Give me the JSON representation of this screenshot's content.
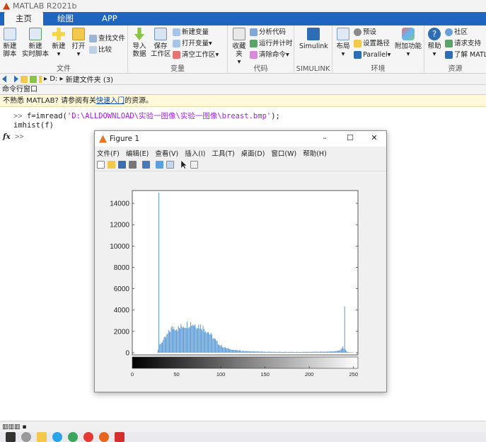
{
  "app": {
    "title": "MATLAB R2021b"
  },
  "tabs": [
    {
      "label": "主页"
    },
    {
      "label": "绘图"
    },
    {
      "label": "APP"
    }
  ],
  "ribbon": {
    "file": {
      "label": "文件",
      "new_script": "新建\n脚本",
      "new_live": "新建\n实时脚本",
      "new": "新建",
      "open": "打开",
      "find_files": "查找文件",
      "compare": "比较"
    },
    "variable": {
      "label": "变量",
      "import": "导入\n数据",
      "save": "保存\n工作区",
      "new_var": "新建变量",
      "open_var": "打开变量",
      "clear_ws": "清空工作区"
    },
    "code": {
      "label": "代码",
      "favorites": "收藏夹",
      "analyze": "分析代码",
      "run_time": "运行并计时",
      "clear_cmd": "清除命令"
    },
    "simulink": {
      "label": "SIMULINK",
      "btn": "Simulink"
    },
    "env": {
      "label": "环境",
      "layout": "布局",
      "prefs": "预设",
      "set_path": "设置路径",
      "parallel": "Parallel",
      "addons": "附加功能"
    },
    "resources": {
      "label": "资源",
      "help": "帮助",
      "community": "社区",
      "support": "请求支持",
      "learn": "了解 MATLAB"
    }
  },
  "path": {
    "drive": "D:",
    "folder": "新建文件夹 (3)"
  },
  "command_window": {
    "title": "命令行窗口",
    "info_prefix": "不熟悉 MATLAB? 请参阅有关",
    "info_link": "快速入门",
    "info_suffix": "的资源。",
    "prompt": ">>",
    "fx": "fx",
    "line1_code": "f=imread(",
    "line1_str": "'D:\\ALLDOWNLOAD\\实验一图像\\实验一图像\\breast.bmp'",
    "line1_end": ");",
    "line2": "imhist(f)"
  },
  "status": {
    "text": "▥▥▥ ▪"
  },
  "figure": {
    "title": "Figure 1",
    "menu": [
      "文件(F)",
      "编辑(E)",
      "查看(V)",
      "插入(I)",
      "工具(T)",
      "桌面(D)",
      "窗口(W)",
      "帮助(H)"
    ],
    "controls": {
      "minimize": "–",
      "maximize": "☐",
      "close": "✕"
    }
  },
  "chart_data": {
    "type": "bar",
    "xlim": [
      0,
      255
    ],
    "ylim": [
      0,
      15000
    ],
    "yticks": [
      0,
      2000,
      4000,
      6000,
      8000,
      10000,
      12000,
      14000
    ],
    "xticks": [
      0,
      50,
      100,
      150,
      200,
      250
    ],
    "bar_color": "#5b9bd5",
    "colorbar": "grayscale 0-255",
    "spikes": [
      {
        "x": 30,
        "y": 15000
      },
      {
        "x": 240,
        "y": 4350
      }
    ],
    "profile": [
      [
        28,
        0
      ],
      [
        30,
        600
      ],
      [
        32,
        900
      ],
      [
        34,
        1100
      ],
      [
        36,
        1300
      ],
      [
        38,
        1500
      ],
      [
        40,
        1800
      ],
      [
        42,
        2100
      ],
      [
        44,
        2300
      ],
      [
        46,
        2450
      ],
      [
        48,
        2500
      ],
      [
        50,
        2400
      ],
      [
        52,
        2350
      ],
      [
        54,
        2400
      ],
      [
        56,
        2550
      ],
      [
        58,
        2650
      ],
      [
        60,
        2700
      ],
      [
        62,
        2750
      ],
      [
        64,
        2800
      ],
      [
        66,
        2850
      ],
      [
        68,
        2800
      ],
      [
        70,
        2750
      ],
      [
        72,
        2700
      ],
      [
        74,
        2650
      ],
      [
        76,
        2600
      ],
      [
        78,
        2550
      ],
      [
        80,
        2450
      ],
      [
        82,
        2300
      ],
      [
        84,
        2150
      ],
      [
        86,
        2000
      ],
      [
        88,
        1800
      ],
      [
        90,
        1600
      ],
      [
        92,
        1400
      ],
      [
        94,
        1200
      ],
      [
        96,
        1000
      ],
      [
        98,
        850
      ],
      [
        100,
        700
      ],
      [
        104,
        520
      ],
      [
        108,
        400
      ],
      [
        112,
        320
      ],
      [
        116,
        260
      ],
      [
        120,
        220
      ],
      [
        125,
        180
      ],
      [
        130,
        150
      ],
      [
        140,
        120
      ],
      [
        150,
        100
      ],
      [
        160,
        90
      ],
      [
        170,
        80
      ],
      [
        180,
        80
      ],
      [
        190,
        80
      ],
      [
        200,
        90
      ],
      [
        210,
        100
      ],
      [
        220,
        110
      ],
      [
        230,
        150
      ],
      [
        235,
        250
      ],
      [
        238,
        600
      ],
      [
        239,
        400
      ],
      [
        241,
        250
      ],
      [
        243,
        100
      ],
      [
        245,
        50
      ],
      [
        250,
        20
      ],
      [
        255,
        0
      ]
    ]
  }
}
